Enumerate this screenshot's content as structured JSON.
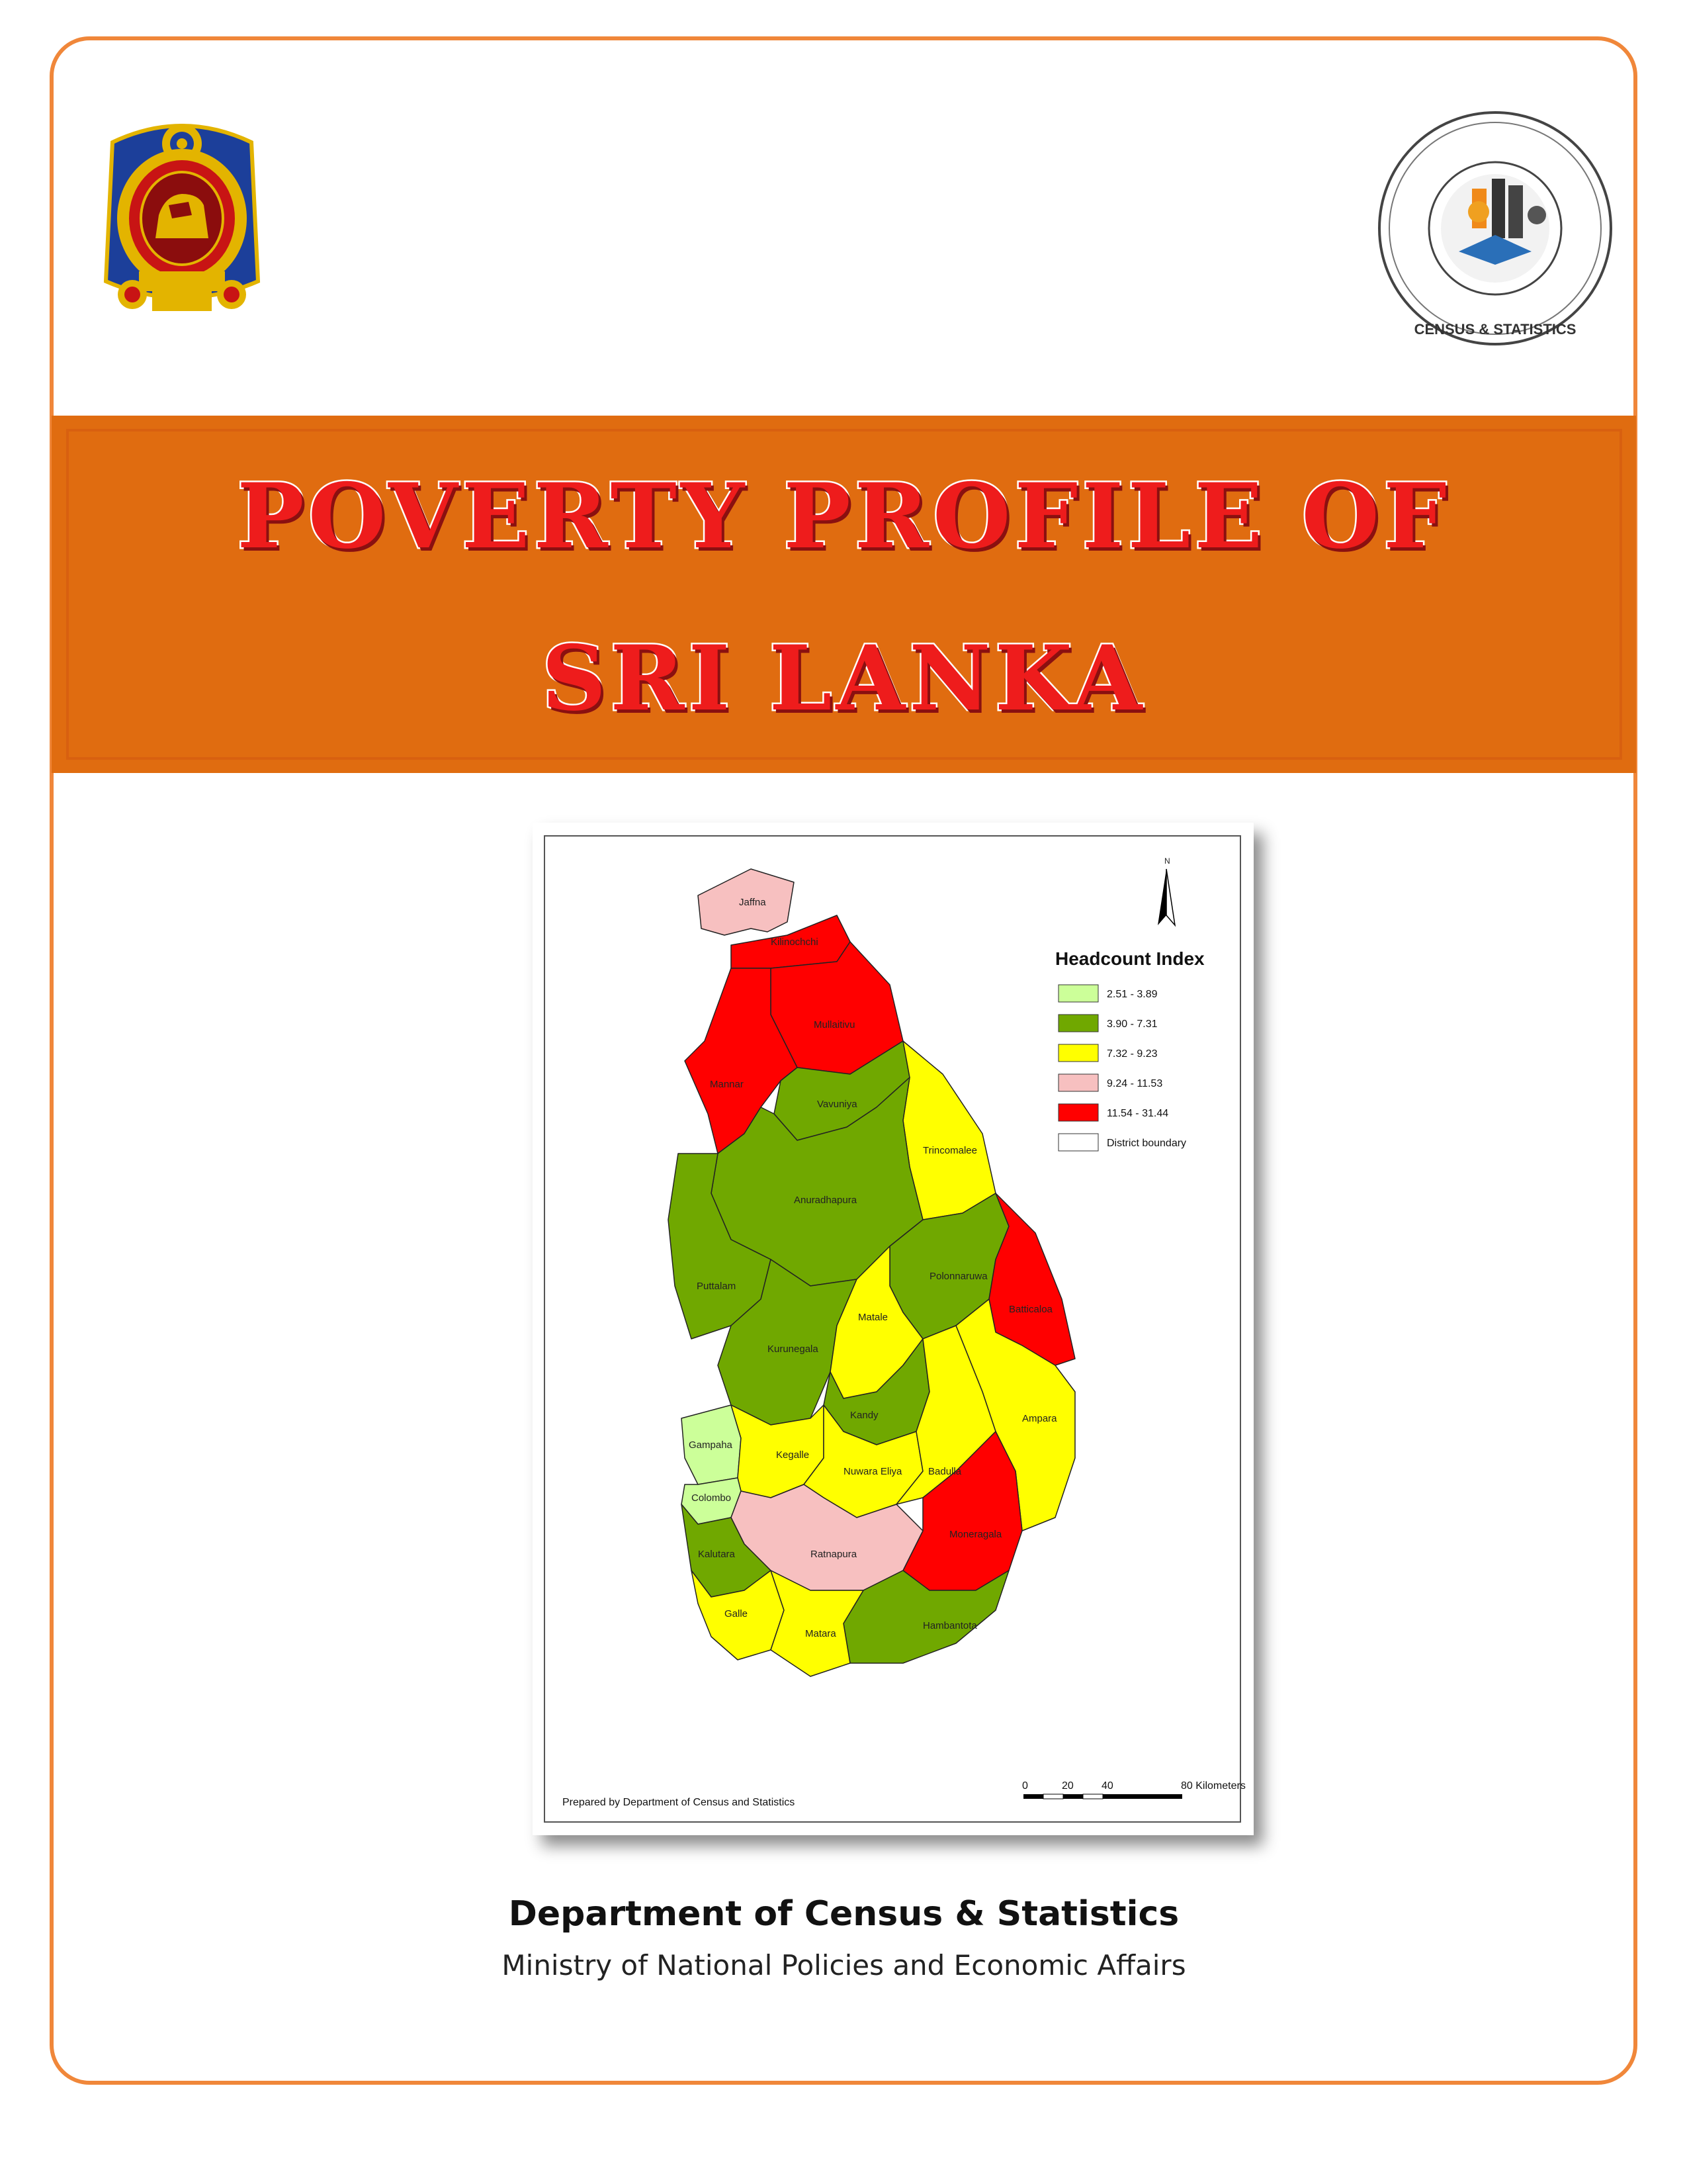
{
  "cover": {
    "title_line1": "POVERTY PROFILE OF",
    "title_line2": "SRI LANKA",
    "organization": "Department of Census & Statistics",
    "ministry": "Ministry of National Policies and Economic Affairs"
  },
  "logos": {
    "left": "sri-lanka-national-emblem",
    "right": "department-of-census-and-statistics-seal",
    "right_seal_text": "CENSUS & STATISTICS"
  },
  "map": {
    "legend_title": "Headcount Index",
    "legend": [
      {
        "label": "2.51 - 3.89",
        "color": "#ccff99"
      },
      {
        "label": "3.90 - 7.31",
        "color": "#70a800"
      },
      {
        "label": "7.32 - 9.23",
        "color": "#ffff00"
      },
      {
        "label": "9.24 - 11.53",
        "color": "#f7c0c0"
      },
      {
        "label": "11.54 - 31.44",
        "color": "#ff0000"
      },
      {
        "label": "District boundary",
        "color": "#ffffff"
      }
    ],
    "north_label": "N",
    "credit": "Prepared by Department of Census and Statistics",
    "scale_labels": [
      "0",
      "20",
      "40",
      "80 Kilometers"
    ],
    "districts": {
      "jaffna": "Jaffna",
      "kilinochchi": "Kilinochchi",
      "mullaitivu": "Mullaitivu",
      "mannar": "Mannar",
      "vavuniya": "Vavuniya",
      "trincomalee": "Trincomalee",
      "anuradhapura": "Anuradhapura",
      "polonnaruwa": "Polonnaruwa",
      "puttalam": "Puttalam",
      "batticaloa": "Batticaloa",
      "kurunegala": "Kurunegala",
      "matale": "Matale",
      "kandy": "Kandy",
      "ampara": "Ampara",
      "gampaha": "Gampaha",
      "kegalle": "Kegalle",
      "nuwara_eliya": "Nuwara Eliya",
      "badulla": "Badulla",
      "colombo": "Colombo",
      "moneragala": "Moneragala",
      "ratnapura": "Ratnapura",
      "kalutara": "Kalutara",
      "hambantota": "Hambantota",
      "galle": "Galle",
      "matara": "Matara"
    }
  }
}
